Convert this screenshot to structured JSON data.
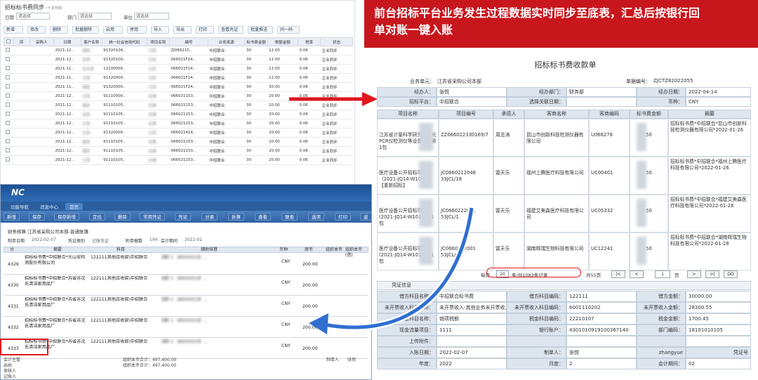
{
  "banner": {
    "line1": "前台招标平台业务发生过程数据实时同步至底表，汇总后按银行回",
    "line2": "单对账一键入账"
  },
  "list": {
    "title": "招标标书费同步",
    "title_note": "(卡源明细)",
    "filters": [
      {
        "label": "日期",
        "value": "请选择"
      },
      {
        "label": "部门",
        "value": "请选择"
      },
      {
        "label": "单位",
        "value": "请选择"
      }
    ],
    "toolbar": [
      "新增",
      "修改",
      "删除",
      "批量删除",
      "启用",
      "停用",
      "导入",
      "导出",
      "打印",
      "查看凭证",
      "批量推送",
      "同一码"
    ],
    "headers": [
      "",
      "序",
      "采购人",
      "日期",
      "客户名称",
      "统一社会信用代码",
      "项目名称",
      "编号",
      "业务来源",
      "标书费金额",
      "税额金额",
      "税率",
      "状态"
    ],
    "rows": [
      [
        "",
        "2021-12..",
        "招标",
        "91320104..",
        "江苏.",
        "ZJ066215..",
        "中招联合",
        "30",
        "12.00",
        "0.06",
        "企业同步"
      ],
      [
        "",
        "2021-12..",
        "化学",
        "91320100..",
        "江苏.",
        "066021F24..",
        "中招联合",
        "30",
        "12.00",
        "0.06",
        "企业同步"
      ],
      [
        "",
        "2021-11..",
        "红大学",
        "12100000..",
        "江苏.",
        "066021F24..",
        "中招联合",
        "30",
        "12.00",
        "0.06",
        "企业同步"
      ],
      [
        "",
        "2021-11..",
        "江苏",
        "91320000..",
        "江苏.",
        "066021F24..",
        "中招联合",
        "30",
        "12.00",
        "0.06",
        "企业同步"
      ],
      [
        "",
        "2021-11..",
        "招标",
        "91320000..",
        "江苏.",
        "066021F24..",
        "中招联合",
        "30",
        "30.00",
        "0.06",
        "企业同步"
      ],
      [
        "",
        "2021-12..",
        "江苏",
        "91110000..",
        "天津.",
        "066021153..",
        "中招联合",
        "30",
        "20.00",
        "0.06",
        "企业同步"
      ],
      [
        "",
        "2021-12..",
        "南京",
        "91110105..",
        "天津.",
        "066021153..",
        "中招联合",
        "30",
        "20.00",
        "0.06",
        "企业同步"
      ],
      [
        "",
        "2021-12..",
        "北京",
        "91110105..",
        "天津.",
        "066021153..",
        "中招联合",
        "30",
        "20.00",
        "0.06",
        "企业同步"
      ],
      [
        "",
        "2021-12..",
        "江苏",
        "91110105..",
        "天津.",
        "066021153..",
        "中招联合",
        "30",
        "20.00",
        "0.06",
        "企业同步"
      ],
      [
        "",
        "2021-12..",
        "江苏",
        "91320000..",
        "江苏.",
        "066021414..",
        "中招联合",
        "30",
        "20.00",
        "0.06",
        "企业同步"
      ],
      [
        "",
        "2021-12..",
        "南京",
        "91110105..",
        "天津.",
        "066021153..",
        "中招联合",
        "30",
        "20.00",
        "0.06",
        "企业同步"
      ],
      [
        "",
        "2021-12..",
        "南京",
        "91110105..",
        "天津.",
        "066021153..",
        "中招联合",
        "30",
        "20.00",
        "0.06",
        "企业同步"
      ],
      [
        "",
        "2021-12..",
        "江苏",
        "91110105..",
        "天津.",
        "066021153..",
        "中招联合",
        "30",
        "20.00",
        "0.06",
        "企业同步"
      ]
    ]
  },
  "form": {
    "title": "招标标书费收款单",
    "biz_unit_label": "业务单元：",
    "biz_unit": "江苏省采购公司本部",
    "doc_no_label": "单据编号：",
    "doc_no": "ZJCTZ82022055",
    "handler_label": "经办人：",
    "handler": "张悦",
    "dept_label": "经办部门：",
    "dept": "财务部",
    "date_label": "经办日期：",
    "date": "2022-04-14",
    "platform_label": "招标平台：",
    "platform": "中招联合",
    "related_label": "选择关联日期：",
    "related": "",
    "currency_label": "币种：",
    "currency": "CNY",
    "grid_headers": [
      "项目名称",
      "项目编号",
      "承揽人",
      "客商名称",
      "客商编码",
      "标书费金额",
      "摘要"
    ],
    "grid_rows": [
      {
        "name": "江苏省计量科学研究院荧光PCR仪检测仪等设备项目第1包",
        "no": "ZZ066022330169/7",
        "person": "周志涛",
        "client": "昆山市创新科技检测仪器有限公司",
        "code": "U068278",
        "amount": "50",
        "memo": "招标标书费*中招联合*昆山市创新科技检测仪器有限公司*2022-01-26"
      },
      {
        "name": "医疗设备公开招标项目（2021-JQ14-W1011）【重新招标】",
        "no": "JC0660212048 33JCL/18",
        "person": "雷天乐",
        "client": "福州上腾医疗科技有限公司",
        "code": "UC00401",
        "amount": "50",
        "memo": "招标标书费*中招联合*福州上腾医疗科技有限公司*2022-01-26"
      },
      {
        "name": "医疗设备公开招标项目(2021-JQ14-W1010)第1包",
        "no": "JC0660222001 53JCL/1",
        "person": "雷天乐",
        "client": "福建艾美森医疗科技有限公司",
        "code": "UC05332",
        "amount": "50",
        "memo": "招标标书费*中招联合*福建艾美森医疗科技有限公司*2022-01-28"
      },
      {
        "name": "医疗设备公开招标项目(2021-JQ14-W1010)第1包",
        "no": "JC0660222001 53JCL/1",
        "person": "雷天乐",
        "client": "湖南辉瑞生物科技有限公司",
        "code": "UC12241",
        "amount": "50",
        "memo": "招标标书费*中招联合*湖南辉瑞生物科技有限公司*2022-01-28"
      }
    ],
    "pager": {
      "prefix": "每页",
      "size": "20",
      "suffix": "条/共1083条记录",
      "total_pages": "共55页",
      "page": "1",
      "page_suffix": "页",
      "go": "GO",
      "first": "|<",
      "prev": "<",
      "next": ">",
      "last": ">|"
    },
    "voucher_title": "凭证信息",
    "voucher": [
      [
        "借方科目名称：",
        "中招联合标书费",
        "借方科目编码：",
        "122111",
        "借方金额：",
        "30000.00"
      ],
      [
        "未开票收入科目名称：",
        "未开票收入-其他业务未开票收入",
        "未开票收入科目编码：",
        "6001110202",
        "未开票收入金额：",
        "28300.55"
      ],
      [
        "税金科目名称：",
        "销项税额",
        "税金科目编码：",
        "22210107",
        "税金金额：",
        "1700.45"
      ],
      [
        "现金流量项目：",
        "1111",
        "银行账户：",
        "4301010919100367140",
        "部门编码：",
        "18101010105"
      ],
      [
        "上传附件：",
        "",
        "",
        "",
        "",
        ""
      ],
      [
        "入账日期：",
        "2022-02-07",
        "制单人：",
        "张悦",
        "zhangyue",
        "凭证号"
      ],
      [
        "年度：",
        "2022",
        "月度：",
        "2",
        "会计期间：",
        "02"
      ]
    ]
  },
  "nc": {
    "logo": "NC",
    "nav": [
      "功能导航",
      "消息中心",
      "首页"
    ],
    "buttons": [
      "新增",
      "保存",
      "保存新增",
      "定位",
      "删除",
      "常用凭证",
      "凭证",
      "分录",
      "折算",
      "查看",
      "联查",
      "选项",
      "打印",
      "返回"
    ],
    "crumb": "财务核算 江苏省采购公司本部-普通账簿",
    "meta": [
      {
        "label": "制单日期",
        "value": "2022-02-07"
      },
      {
        "label": "凭证类别",
        "value": "记账凭证"
      },
      {
        "label": "附单据数",
        "value": "194"
      },
      {
        "label": "会计期间",
        "value": "2022-02"
      }
    ],
    "grid_headers": [
      "分",
      "摘要",
      "科目",
      "辅助核算",
      "币种",
      "原币",
      "组织本币",
      "组织本币(借)"
    ],
    "rows": [
      {
        "no": "4329",
        "memo": "招标标书费*中招联合*大山安检测股份有限公司",
        "subj": "122111其他应收款\\中招联合",
        "aux": "【部门：18101013】...",
        "cur": "CNY",
        "amt": "200.00"
      },
      {
        "no": "4330",
        "memo": "招标标书费*中招联合*苏省苏沈氏清洁家用品厂",
        "subj": "122111其他应收款\\中招联合",
        "aux": "【部门：18101013】...",
        "cur": "CNY",
        "amt": "200.00"
      },
      {
        "no": "4331",
        "memo": "招标标书费*中招联合*苏省苏沈氏清洁家用品厂",
        "subj": "122111其他应收款\\中招联合",
        "aux": "【部门：18101013】...",
        "cur": "CNY",
        "amt": "200.00"
      },
      {
        "no": "4332",
        "memo": "招标标书费*中招联合*苏省苏沈氏清洁家用品厂",
        "subj": "122111其他应收款\\中招联合",
        "aux": "【部门：18101013】...",
        "cur": "CNY",
        "amt": "200.00"
      },
      {
        "no": "4333",
        "memo": "招标标书费*中招联合*苏省苏沈氏清洁家用品厂",
        "subj": "122111其他应收款\\中招联合",
        "aux": "【部门：18101013】...",
        "cur": "CNY",
        "amt": "200.00"
      }
    ],
    "footer": [
      "会计主管",
      "出纳",
      "审核人",
      "记账人",
      "组织本币合计：497,400.00",
      "组织本币合计：497,400.00",
      "制单人",
      "张悦"
    ]
  }
}
